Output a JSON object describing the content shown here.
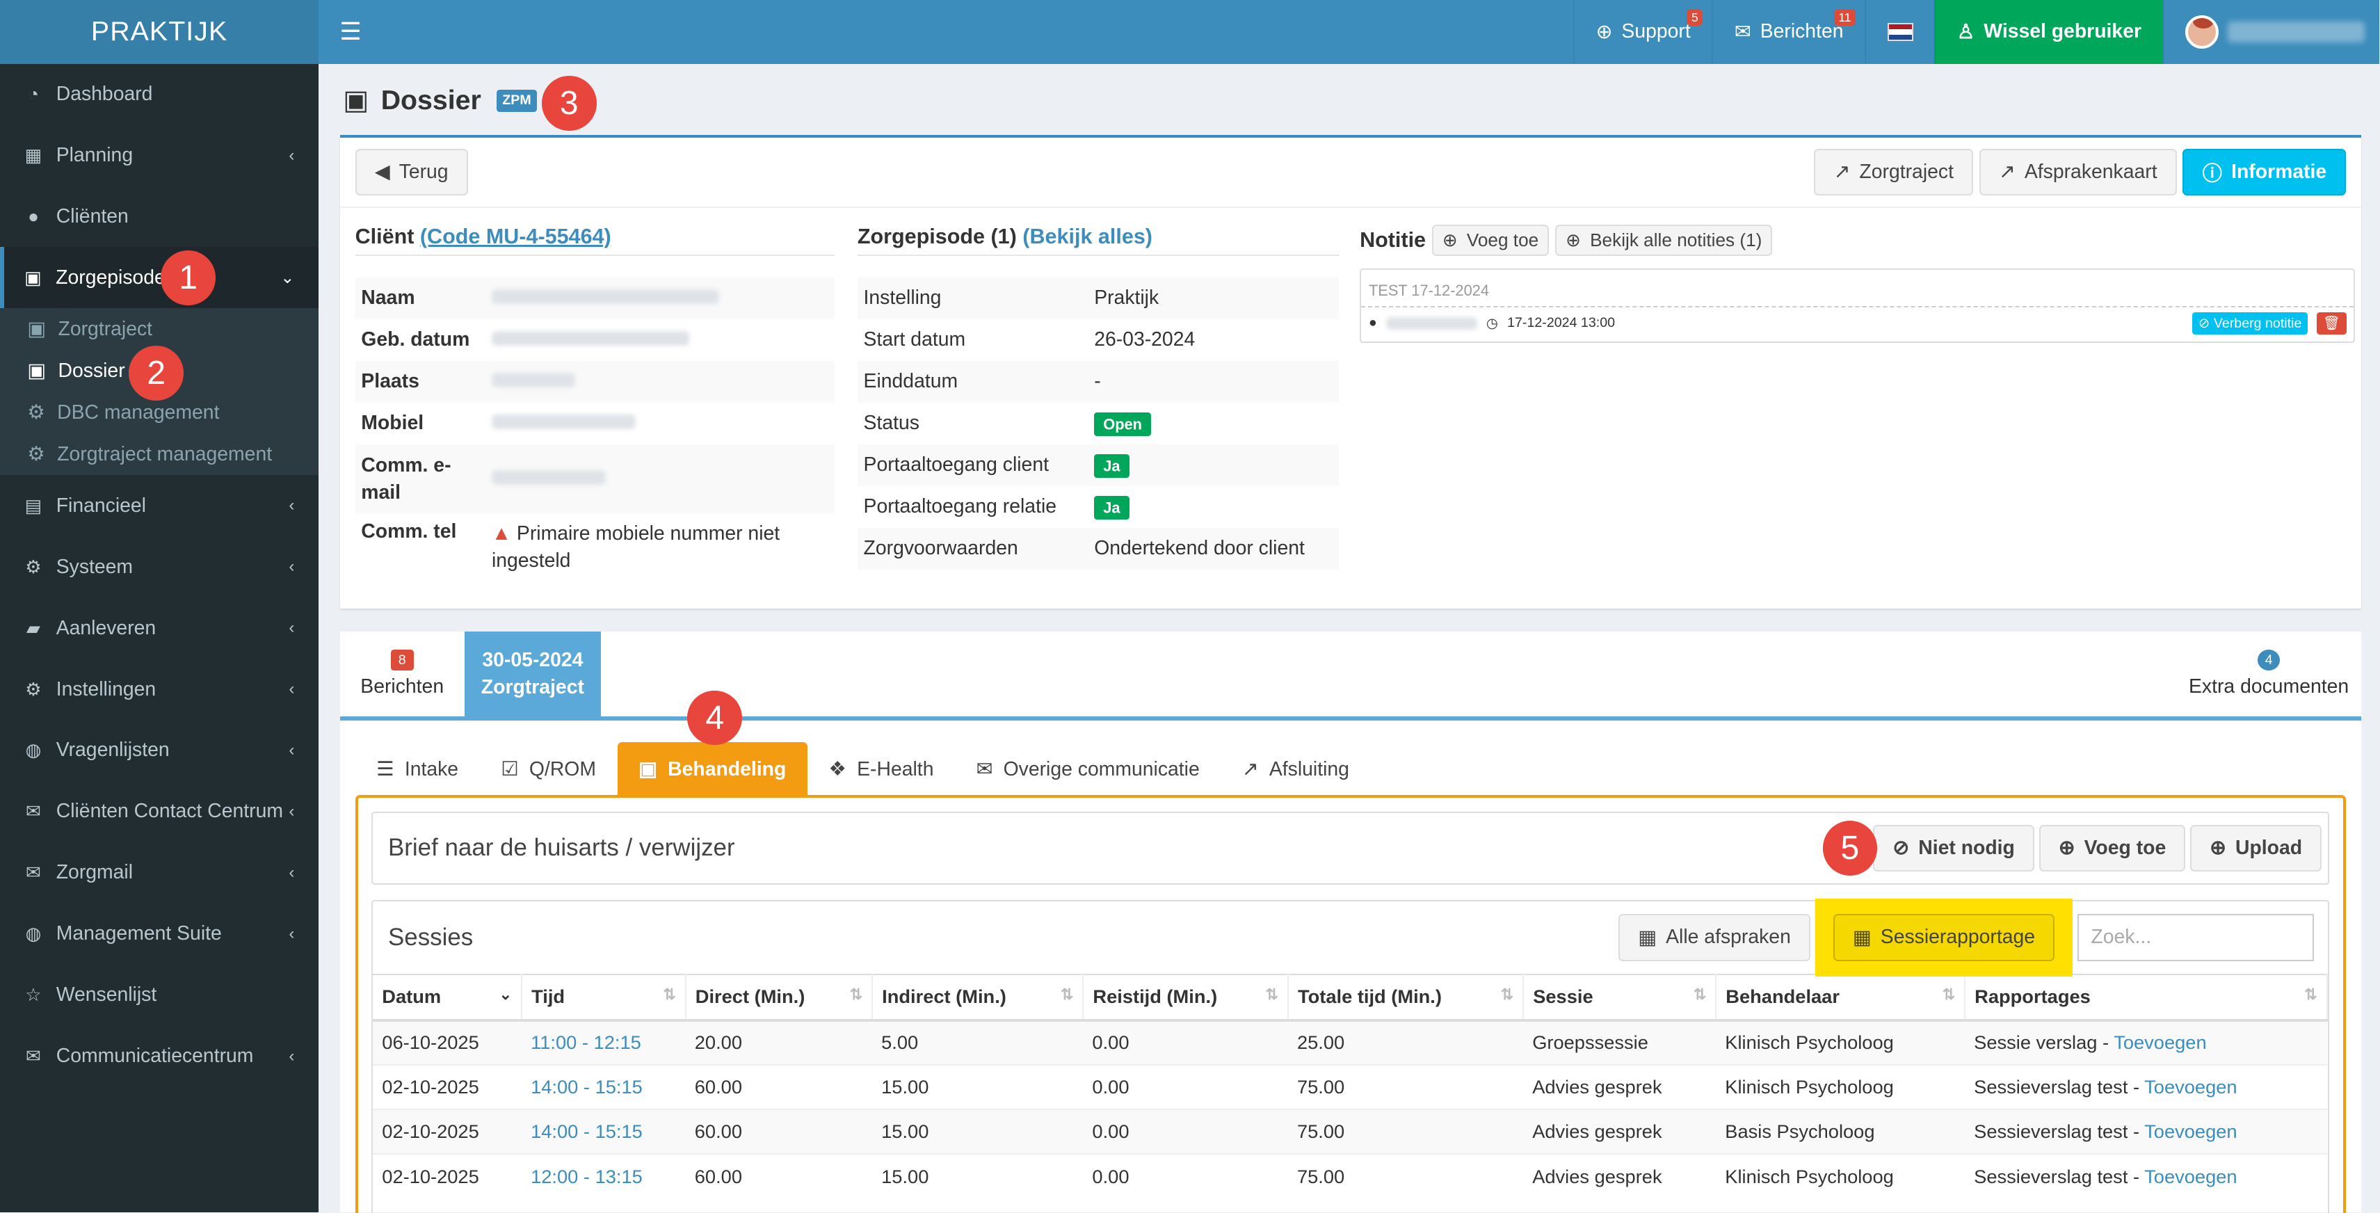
{
  "header": {
    "logo": "PRAKTIJK",
    "support": "Support",
    "support_count": "5",
    "messages": "Berichten",
    "messages_count": "11",
    "switch_user": "Wissel gebruiker"
  },
  "sidebar": {
    "items": [
      {
        "label": "Dashboard",
        "icon": "dashboard-icon"
      },
      {
        "label": "Planning",
        "icon": "calendar-icon"
      },
      {
        "label": "Cliënten",
        "icon": "user-icon"
      },
      {
        "label": "Zorgepisode",
        "icon": "medkit-icon"
      },
      {
        "label": "Financieel",
        "icon": "book-icon"
      },
      {
        "label": "Systeem",
        "icon": "cogs-icon"
      },
      {
        "label": "Aanleveren",
        "icon": "truck-icon"
      },
      {
        "label": "Instellingen",
        "icon": "cog-icon"
      },
      {
        "label": "Vragenlijsten",
        "icon": "globe-icon"
      },
      {
        "label": "Cliënten Contact Centrum",
        "icon": "envelope-icon"
      },
      {
        "label": "Zorgmail",
        "icon": "envelope-icon"
      },
      {
        "label": "Management Suite",
        "icon": "globe-icon"
      },
      {
        "label": "Wensenlijst",
        "icon": "star-icon"
      },
      {
        "label": "Communicatiecentrum",
        "icon": "envelope-icon"
      }
    ],
    "sub": [
      "Zorgtraject",
      "Dossier",
      "DBC management",
      "Zorgtraject management"
    ]
  },
  "steps": [
    "1",
    "2",
    "3",
    "4",
    "5"
  ],
  "page": {
    "title": "Dossier",
    "badge": "ZPM"
  },
  "toolbar": {
    "back": "Terug",
    "zorgtraject": "Zorgtraject",
    "afsprakenkaart": "Afsprakenkaart",
    "informatie": "Informatie"
  },
  "client": {
    "heading": "Cliënt",
    "code": "(Code MU-4-55464)",
    "rows": [
      {
        "k": "Naam",
        "v": ""
      },
      {
        "k": "Geb. datum",
        "v": ""
      },
      {
        "k": "Plaats",
        "v": ""
      },
      {
        "k": "Mobiel",
        "v": ""
      },
      {
        "k": "Comm. e-mail",
        "v": ""
      },
      {
        "k": "Comm. tel",
        "v": "Primaire mobiele nummer niet ingesteld"
      }
    ]
  },
  "episode": {
    "heading": "Zorgepisode (1)",
    "link": "(Bekijk alles)",
    "rows": [
      {
        "k": "Instelling",
        "v": "Praktijk"
      },
      {
        "k": "Start datum",
        "v": "26-03-2024"
      },
      {
        "k": "Einddatum",
        "v": "-"
      },
      {
        "k": "Status",
        "v": "Open"
      },
      {
        "k": "Portaaltoegang client",
        "v": "Ja"
      },
      {
        "k": "Portaaltoegang relatie",
        "v": "Ja"
      },
      {
        "k": "Zorgvoorwaarden",
        "v": "Ondertekend door client"
      }
    ]
  },
  "notes": {
    "heading": "Notitie",
    "add": "Voeg toe",
    "all": "Bekijk alle notities (1)",
    "item_title": "TEST 17-12-2024",
    "item_time": "17-12-2024 13:00",
    "hide": "Verberg notitie"
  },
  "toptabs": {
    "berichten_count": "8",
    "berichten": "Berichten",
    "date": "30-05-2024",
    "zorgtraject": "Zorgtraject",
    "extra_count": "4",
    "extra": "Extra documenten"
  },
  "subtabs": [
    "Intake",
    "Q/ROM",
    "Behandeling",
    "E-Health",
    "Overige communicatie",
    "Afsluiting"
  ],
  "brief": {
    "title": "Brief naar de huisarts / verwijzer",
    "not_needed": "Niet nodig",
    "add": "Voeg toe",
    "upload": "Upload"
  },
  "sessions": {
    "title": "Sessies",
    "all_appointments": "Alle afspraken",
    "report": "Sessierapportage",
    "search_placeholder": "Zoek...",
    "columns": [
      "Datum",
      "Tijd",
      "Direct (Min.)",
      "Indirect (Min.)",
      "Reistijd (Min.)",
      "Totale tijd (Min.)",
      "Sessie",
      "Behandelaar",
      "Rapportages"
    ],
    "rows": [
      [
        "06-10-2025",
        "11:00 - 12:15",
        "20.00",
        "5.00",
        "0.00",
        "25.00",
        "Groepssessie",
        "Klinisch Psycholoog",
        "Sessie verslag",
        "Toevoegen"
      ],
      [
        "02-10-2025",
        "14:00 - 15:15",
        "60.00",
        "15.00",
        "0.00",
        "75.00",
        "Advies gesprek",
        "Klinisch Psycholoog",
        "Sessieverslag test",
        "Toevoegen"
      ],
      [
        "02-10-2025",
        "14:00 - 15:15",
        "60.00",
        "15.00",
        "0.00",
        "75.00",
        "Advies gesprek",
        "Basis Psycholoog",
        "Sessieverslag test",
        "Toevoegen"
      ],
      [
        "02-10-2025",
        "12:00 - 13:15",
        "60.00",
        "15.00",
        "0.00",
        "75.00",
        "Advies gesprek",
        "Klinisch Psycholoog",
        "Sessieverslag test",
        "Toevoegen"
      ]
    ]
  }
}
